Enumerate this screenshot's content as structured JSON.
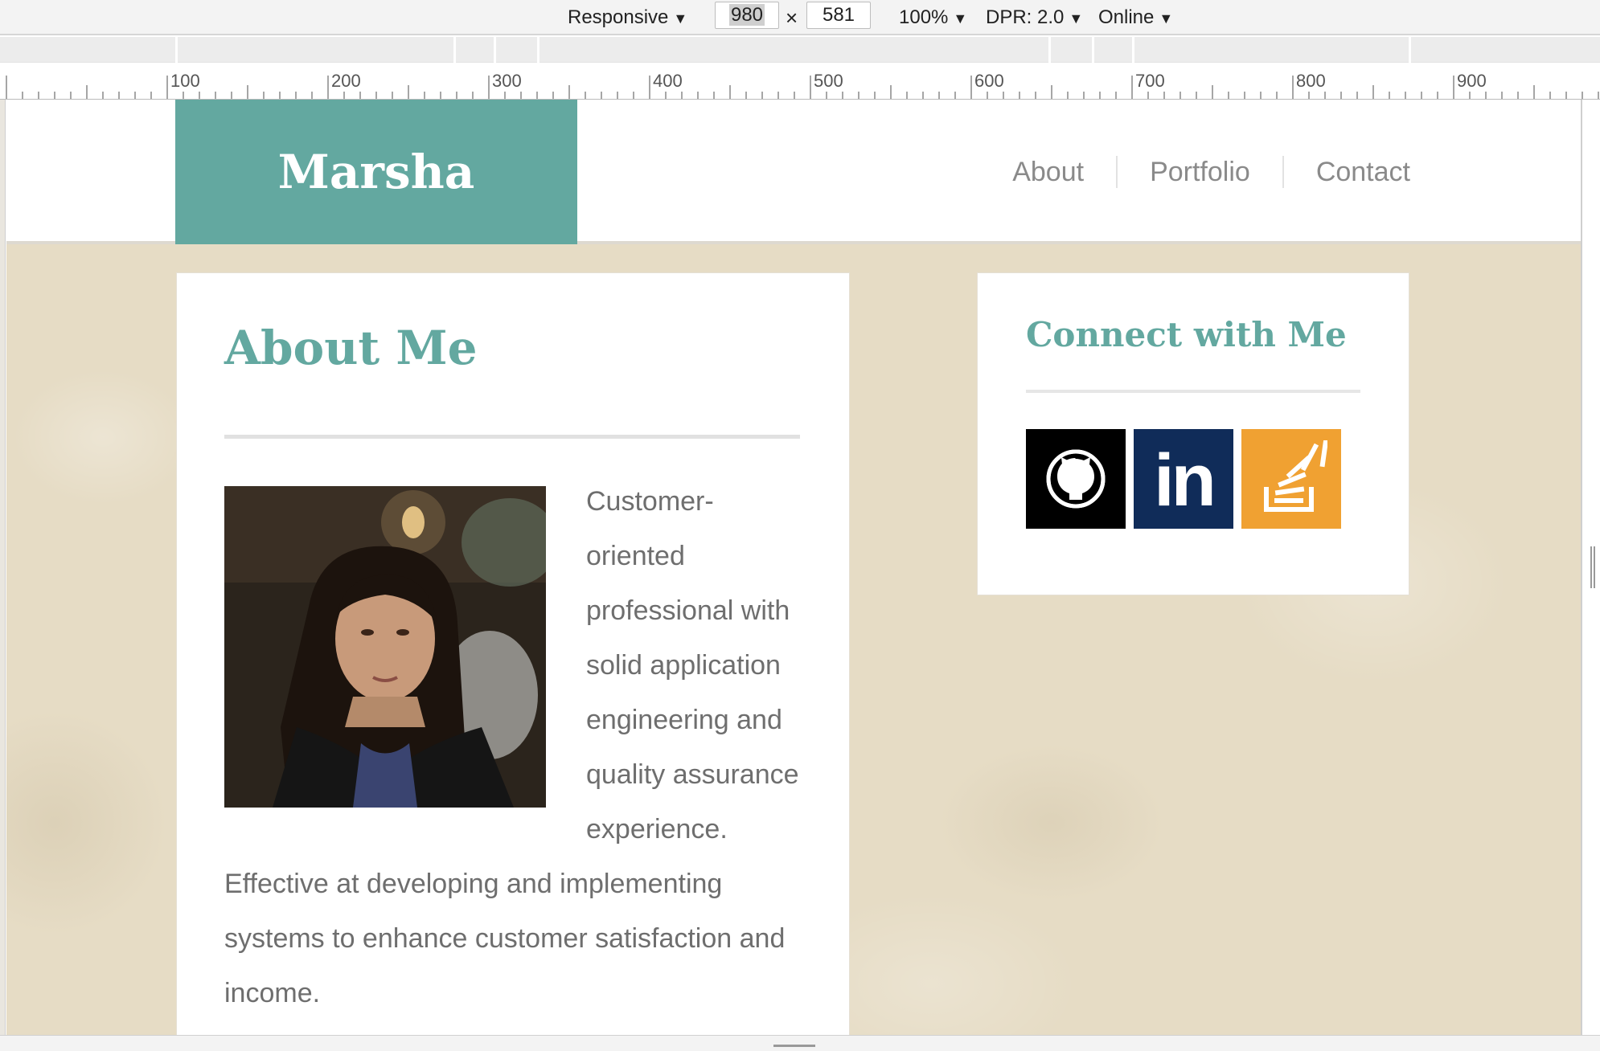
{
  "devtools": {
    "device_mode": "Responsive",
    "width_value": "980",
    "separator": "×",
    "height_value": "581",
    "zoom": "100%",
    "dpr": "DPR: 2.0",
    "network": "Online",
    "ruler_labels": [
      "100",
      "200",
      "300",
      "400",
      "500",
      "600",
      "700",
      "800",
      "900"
    ]
  },
  "site": {
    "logo": "Marsha",
    "nav": [
      "About",
      "Portfolio",
      "Contact"
    ]
  },
  "about": {
    "title": "About Me",
    "photo_alt": "portrait-photo",
    "text": "Customer-oriented professional with solid application engineering and quality assurance experience. Effective at developing and implementing systems to enhance customer satisfaction and income."
  },
  "connect": {
    "title": "Connect with Me",
    "links": [
      {
        "icon": "github-icon",
        "color": "#000000"
      },
      {
        "icon": "linkedin-icon",
        "color": "#102c59",
        "label": "in"
      },
      {
        "icon": "stackoverflow-icon",
        "color": "#f0a132"
      }
    ]
  },
  "colors": {
    "accent": "#63a8a0",
    "nav_text": "#8a8a8a",
    "body_text": "#6e6e6e",
    "page_bg": "#e6dcc5"
  }
}
